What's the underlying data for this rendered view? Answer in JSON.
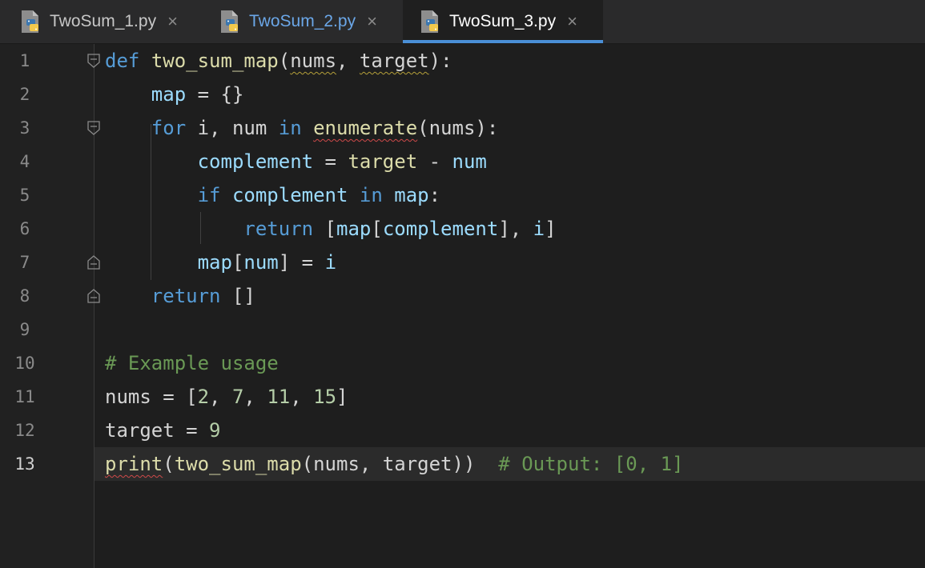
{
  "tabs": [
    {
      "label": "TwoSum_1.py",
      "close": "×",
      "icon": "python-file-icon"
    },
    {
      "label": "TwoSum_2.py",
      "close": "×",
      "icon": "python-file-icon"
    },
    {
      "label": "TwoSum_3.py",
      "close": "×",
      "icon": "python-file-icon",
      "active": true
    }
  ],
  "colors": {
    "accent": "#4a8fd6",
    "keyword": "#569cd6",
    "function": "#dcdcaa",
    "variable": "#9cdcfe",
    "number": "#b5cea8",
    "comment": "#6a9955"
  },
  "line_numbers": [
    "1",
    "2",
    "3",
    "4",
    "5",
    "6",
    "7",
    "8",
    "9",
    "10",
    "11",
    "12",
    "13"
  ],
  "current_line": "13",
  "code": {
    "l1": {
      "kw": "def",
      "sp": " ",
      "fn": "two_sum_map",
      "p1": "(",
      "a1": "nums",
      "c1": ", ",
      "a2": "target",
      "p2": "):"
    },
    "l2": {
      "indent": "    ",
      "v": "map",
      "rest": " = {}"
    },
    "l3": {
      "indent": "    ",
      "kw": "for",
      "t1": " i, num ",
      "kw2": "in",
      "sp": " ",
      "fn": "enumerate",
      "t2": "(nums):"
    },
    "l4": {
      "indent": "        ",
      "v": "complement",
      "t1": " = ",
      "fn": "target",
      "t2": " - ",
      "v2": "num"
    },
    "l5": {
      "indent": "        ",
      "kw": "if",
      "sp": " ",
      "v": "complement",
      "sp2": " ",
      "kw2": "in",
      "sp3": " ",
      "v2": "map",
      "t": ":"
    },
    "l6": {
      "indent": "            ",
      "kw": "return",
      "t1": " [",
      "v": "map",
      "t2": "[",
      "v2": "complement",
      "t3": "], ",
      "v3": "i",
      "t4": "]"
    },
    "l7": {
      "indent": "        ",
      "v": "map",
      "t1": "[",
      "v2": "num",
      "t2": "] = ",
      "v3": "i"
    },
    "l8": {
      "indent": "    ",
      "kw": "return",
      "t": " []"
    },
    "l10": {
      "cmt": "# Example usage"
    },
    "l11": {
      "t1": "nums = [",
      "n1": "2",
      "c1": ", ",
      "n2": "7",
      "c2": ", ",
      "n3": "11",
      "c3": ", ",
      "n4": "15",
      "t2": "]"
    },
    "l12": {
      "t1": "target = ",
      "n1": "9"
    },
    "l13": {
      "fn": "print",
      "t1": "(",
      "fn2": "two_sum_map",
      "t2": "(nums, target))  ",
      "cmt": "# Output: [0, 1]"
    }
  }
}
